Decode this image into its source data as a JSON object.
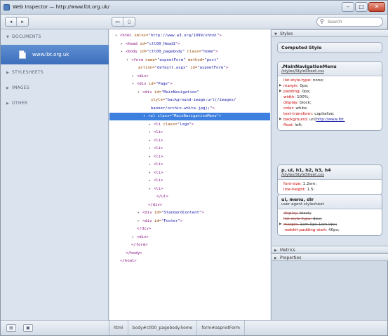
{
  "window": {
    "title": "Web Inspector — http://www.lbt.org.uk/",
    "search_placeholder": "Search"
  },
  "toolbar": {
    "back_icon": "◂",
    "forward_icon": "▸",
    "dock_icon_a": "▭",
    "dock_icon_b": "▯"
  },
  "sidebar": {
    "documents_label": "DOCUMENTS",
    "selected_item": "www.lbt.org.uk",
    "stylesheets_label": "STYLESHEETS",
    "images_label": "IMAGES",
    "other_label": "OTHER"
  },
  "dom_tree": [
    {
      "tri": "▾",
      "tag": "<html",
      "attrs": [
        {
          "n": " xmlns=",
          "v": "\"http://www.w3.org/1999/xhtml\""
        }
      ],
      "end": ">"
    },
    {
      "tri": "▸",
      "tag": "<head",
      "attrs": [
        {
          "n": " id=",
          "v": "\"ctl00_Head1\""
        }
      ],
      "end": ">"
    },
    {
      "tri": "▾",
      "tag": "<body",
      "attrs": [
        {
          "n": " id=",
          "v": "\"ctl00_pagebody\""
        },
        {
          "n": " class=",
          "v": "\"home\""
        }
      ],
      "end": ">"
    },
    {
      "tri": "▾",
      "tag": "<form",
      "attrs": [
        {
          "n": " name=",
          "v": "\"aspnetForm\""
        },
        {
          "n": " method=",
          "v": "\"post\""
        }
      ],
      "end": ""
    },
    {
      "tri": "",
      "tag": "",
      "attrs": [
        {
          "n": "action=",
          "v": "\"default.aspx\""
        },
        {
          "n": " id=",
          "v": "\"aspnetForm\""
        }
      ],
      "end": ">"
    },
    {
      "tri": "▸",
      "tag": "<div",
      "attrs": [],
      "end": ">"
    },
    {
      "tri": "▾",
      "tag": "<div",
      "attrs": [
        {
          "n": " id=",
          "v": "\"Page\""
        }
      ],
      "end": ">"
    },
    {
      "tri": "▾",
      "tag": "<div",
      "attrs": [
        {
          "n": " id=",
          "v": "\"MainNavigation\""
        }
      ],
      "end": ""
    },
    {
      "tri": "",
      "tag": "",
      "attrs": [
        {
          "n": "style=",
          "v": "\"background-image:url(/images/"
        }
      ],
      "end": ""
    },
    {
      "tri": "",
      "tag": "",
      "attrs": [
        {
          "n": "",
          "v": "banner/orchin-white.jpg);\""
        }
      ],
      "end": ">"
    },
    {
      "tri": "▾",
      "tag": "<ul",
      "attrs": [
        {
          "n": " class=",
          "v": "\"MainNavigationMenu\""
        }
      ],
      "end": ">"
    },
    {
      "tri": "▸",
      "tag": "<li",
      "attrs": [
        {
          "n": " class=",
          "v": "\"logo\""
        }
      ],
      "end": ">"
    },
    {
      "tri": "▸",
      "tag": "<li",
      "attrs": [],
      "end": ">"
    },
    {
      "tri": "▸",
      "tag": "<li",
      "attrs": [],
      "end": ">"
    },
    {
      "tri": "▸",
      "tag": "<li",
      "attrs": [],
      "end": ">"
    },
    {
      "tri": "▸",
      "tag": "<li",
      "attrs": [],
      "end": ">"
    },
    {
      "tri": "▸",
      "tag": "<li",
      "attrs": [],
      "end": ">"
    },
    {
      "tri": "▸",
      "tag": "<li",
      "attrs": [],
      "end": ">"
    },
    {
      "tri": "▸",
      "tag": "<li",
      "attrs": [],
      "end": ">"
    },
    {
      "tri": "▸",
      "tag": "<li",
      "attrs": [],
      "end": ">"
    },
    {
      "tri": "",
      "tag": "</ul",
      "attrs": [],
      "end": ">"
    },
    {
      "tri": "",
      "tag": "</div",
      "attrs": [],
      "end": ">"
    },
    {
      "tri": "▸",
      "tag": "<div",
      "attrs": [
        {
          "n": " id=",
          "v": "\"StandardContent\""
        }
      ],
      "end": ">"
    },
    {
      "tri": "▸",
      "tag": "<div",
      "attrs": [
        {
          "n": " id=",
          "v": "\"Footer\""
        }
      ],
      "end": ">"
    },
    {
      "tri": "",
      "tag": "</div",
      "attrs": [],
      "end": ">"
    },
    {
      "tri": "▸",
      "tag": "<div",
      "attrs": [],
      "end": ">"
    },
    {
      "tri": "",
      "tag": "</form",
      "attrs": [],
      "end": ">"
    },
    {
      "tri": "",
      "tag": "</body",
      "attrs": [],
      "end": ">"
    },
    {
      "tri": "",
      "tag": "</html",
      "attrs": [],
      "end": ">"
    }
  ],
  "breadcrumbs": [
    "html",
    "body#ctl00_pagebody.home",
    "form#aspnetForm"
  ],
  "right_pane": {
    "styles_label": "Styles",
    "computed_style_label": "Computed Style",
    "metrics_label": "Metrics",
    "properties_label": "Properties",
    "rules": [
      {
        "selector": ".MainNavigationMenu",
        "source": "/styles/StyleSheet.css",
        "props": [
          {
            "name": "list-style-type",
            "value": "none;",
            "exp": false,
            "struck": false
          },
          {
            "name": "margin",
            "value": "0px;",
            "exp": true,
            "struck": false
          },
          {
            "name": "padding",
            "value": "0px;",
            "exp": true,
            "struck": false
          },
          {
            "name": "width",
            "value": "100%;",
            "exp": false,
            "struck": false
          },
          {
            "name": "display",
            "value": "block;",
            "exp": false,
            "struck": false
          },
          {
            "name": "color",
            "value": "white;",
            "exp": false,
            "struck": false
          },
          {
            "name": "text-transform",
            "value": "capitalize;",
            "exp": false,
            "struck": false
          },
          {
            "name": "background",
            "value": "url(",
            "link": "http://www.lbt.",
            "exp": true,
            "struck": false
          },
          {
            "name": "float",
            "value": "left;",
            "exp": false,
            "struck": false
          }
        ]
      },
      {
        "selector": "p, ul, h1, h2, h3, h4",
        "source": "/styles/StyleSheet.css",
        "props": [
          {
            "name": "font-size",
            "value": "1.2em;",
            "exp": false,
            "struck": false
          },
          {
            "name": "line-height",
            "value": "1.5;",
            "exp": false,
            "struck": false
          }
        ]
      },
      {
        "selector": "ul, menu, dir",
        "source": "user agent stylesheet",
        "props": [
          {
            "name": "display",
            "value": "block;",
            "exp": false,
            "struck": true
          },
          {
            "name": "list-style-type",
            "value": "disc;",
            "exp": false,
            "struck": true
          },
          {
            "name": "margin",
            "value": "1em 0px 1em 0px;",
            "exp": true,
            "struck": true
          },
          {
            "name": "-webkit-padding-start",
            "value": "40px;",
            "exp": false,
            "struck": false
          }
        ]
      }
    ]
  },
  "colors": {
    "selection": "#3d80df",
    "tag": "#881280",
    "attr": "#994500",
    "value": "#1a1aa6",
    "prop_name": "#c80000"
  }
}
